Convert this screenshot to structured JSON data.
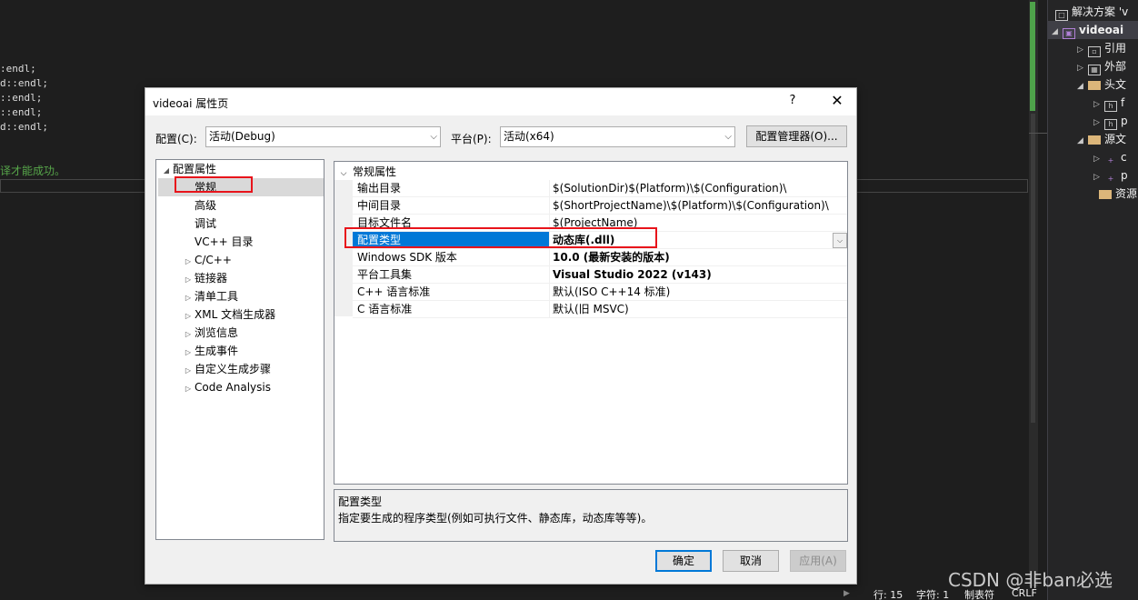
{
  "editor": {
    "code_lines": [
      ":endl;",
      "d::endl;",
      "::endl;",
      "::endl;",
      "d::endl;"
    ],
    "comment_line": "译才能成功。"
  },
  "solution_explorer": {
    "items": [
      {
        "label": "解决方案 'v",
        "arrow": "",
        "icon": "□"
      },
      {
        "label": "videoai",
        "arrow": "◢",
        "icon": "▣"
      },
      {
        "label": "引用",
        "arrow": "▷",
        "icon": "▫"
      },
      {
        "label": "外部",
        "arrow": "▷",
        "icon": "▦"
      },
      {
        "label": "头文",
        "arrow": "◢",
        "icon": ""
      },
      {
        "label": "f",
        "arrow": "▷",
        "icon": "h"
      },
      {
        "label": "p",
        "arrow": "▷",
        "icon": "h"
      },
      {
        "label": "源文",
        "arrow": "◢",
        "icon": ""
      },
      {
        "label": "c",
        "arrow": "▷",
        "icon": "+"
      },
      {
        "label": "p",
        "arrow": "▷",
        "icon": "+"
      },
      {
        "label": "资源",
        "arrow": "",
        "icon": ""
      }
    ]
  },
  "statusbar": {
    "line": "行: 15",
    "char": "字符: 1",
    "tab": "制表符",
    "eol": "CRLF",
    "arrow": "▶"
  },
  "watermark": "CSDN @非ban必选",
  "dialog": {
    "title": "videoai 属性页",
    "help": "?",
    "close": "✕",
    "config_label": "配置(C):",
    "config_value": "活动(Debug)",
    "platform_label": "平台(P):",
    "platform_value": "活动(x64)",
    "config_manager": "配置管理器(O)...",
    "chevron": "⌵",
    "tree": [
      {
        "label": "配置属性",
        "toggle": "◢",
        "level": 0
      },
      {
        "label": "常规",
        "toggle": "",
        "level": 1
      },
      {
        "label": "高级",
        "toggle": "",
        "level": 1
      },
      {
        "label": "调试",
        "toggle": "",
        "level": 1
      },
      {
        "label": "VC++ 目录",
        "toggle": "",
        "level": 1
      },
      {
        "label": "C/C++",
        "toggle": "▷",
        "level": 1
      },
      {
        "label": "链接器",
        "toggle": "▷",
        "level": 1
      },
      {
        "label": "清单工具",
        "toggle": "▷",
        "level": 1
      },
      {
        "label": "XML 文档生成器",
        "toggle": "▷",
        "level": 1
      },
      {
        "label": "浏览信息",
        "toggle": "▷",
        "level": 1
      },
      {
        "label": "生成事件",
        "toggle": "▷",
        "level": 1
      },
      {
        "label": "自定义生成步骤",
        "toggle": "▷",
        "level": 1
      },
      {
        "label": "Code Analysis",
        "toggle": "▷",
        "level": 1
      }
    ],
    "grid": {
      "category": "常规属性",
      "category_toggle": "⌵",
      "rows": [
        {
          "name": "输出目录",
          "value": "$(SolutionDir)$(Platform)\\$(Configuration)\\"
        },
        {
          "name": "中间目录",
          "value": "$(ShortProjectName)\\$(Platform)\\$(Configuration)\\"
        },
        {
          "name": "目标文件名",
          "value": "$(ProjectName)"
        },
        {
          "name": "配置类型",
          "value": "动态库(.dll)"
        },
        {
          "name": "Windows SDK 版本",
          "value": "10.0 (最新安装的版本)"
        },
        {
          "name": "平台工具集",
          "value": "Visual Studio 2022 (v143)"
        },
        {
          "name": "C++ 语言标准",
          "value": "默认(ISO C++14 标准)"
        },
        {
          "name": "C 语言标准",
          "value": "默认(旧 MSVC)"
        }
      ],
      "dropdown_glyph": "⌵"
    },
    "description": {
      "title": "配置类型",
      "text": "指定要生成的程序类型(例如可执行文件、静态库，动态库等等)。"
    },
    "buttons": {
      "ok": "确定",
      "cancel": "取消",
      "apply": "应用(A)"
    }
  }
}
